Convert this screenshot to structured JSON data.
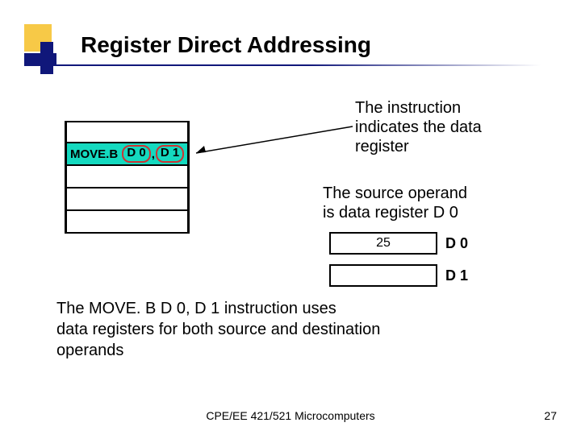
{
  "title": "Register Direct Addressing",
  "instruction": {
    "mnemonic": "MOVE.B ",
    "src": "D 0",
    "comma": ",",
    "dst": "D 1"
  },
  "annotation1": {
    "line1": "The instruction",
    "line2": "indicates the data",
    "line3": "register"
  },
  "annotation2": {
    "line1": "The source operand",
    "line2": "is data register D 0"
  },
  "registers": {
    "d0": {
      "value": "25",
      "label": "D 0"
    },
    "d1": {
      "value": "",
      "label": "D 1"
    }
  },
  "explanation": {
    "line1": "The MOVE. B D 0, D 1 instruction uses",
    "line2": "data registers for both source and destination",
    "line3": "operands"
  },
  "footer": "CPE/EE 421/521 Microcomputers",
  "page": "27"
}
